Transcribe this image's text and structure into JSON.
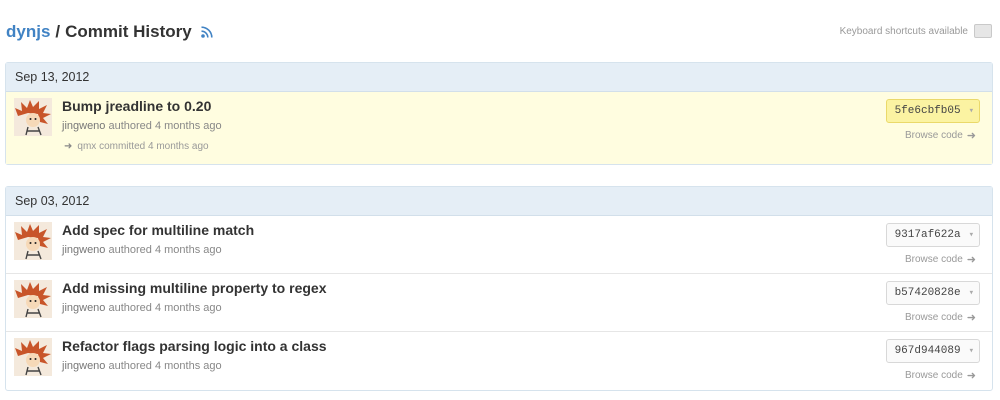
{
  "header": {
    "repo": "dynjs",
    "separator": "/",
    "title": "Commit History",
    "rss_icon": "rss-icon"
  },
  "shortcuts": {
    "label": "Keyboard shortcuts available"
  },
  "groups": [
    {
      "date": "Sep 13, 2012",
      "commits": [
        {
          "message": "Bump jreadline to 0.20",
          "author": "jingweno",
          "authored_text": "authored 4 months ago",
          "committer": "qmx",
          "committed_text": "committed 4 months ago",
          "sha": "5fe6cbfb05",
          "browse": "Browse code",
          "highlighted": true
        }
      ]
    },
    {
      "date": "Sep 03, 2012",
      "commits": [
        {
          "message": "Add spec for multiline match",
          "author": "jingweno",
          "authored_text": "authored 4 months ago",
          "sha": "9317af622a",
          "browse": "Browse code"
        },
        {
          "message": "Add missing multiline property to regex",
          "author": "jingweno",
          "authored_text": "authored 4 months ago",
          "sha": "b57420828e",
          "browse": "Browse code"
        },
        {
          "message": "Refactor flags parsing logic into a class",
          "author": "jingweno",
          "authored_text": "authored 4 months ago",
          "sha": "967d944089",
          "browse": "Browse code"
        }
      ]
    }
  ],
  "colors": {
    "link": "#4183c4",
    "date_header_bg": "#e5eef6",
    "highlight_bg": "#fffde0",
    "sha_highlight_bg": "#fbf3a2"
  }
}
